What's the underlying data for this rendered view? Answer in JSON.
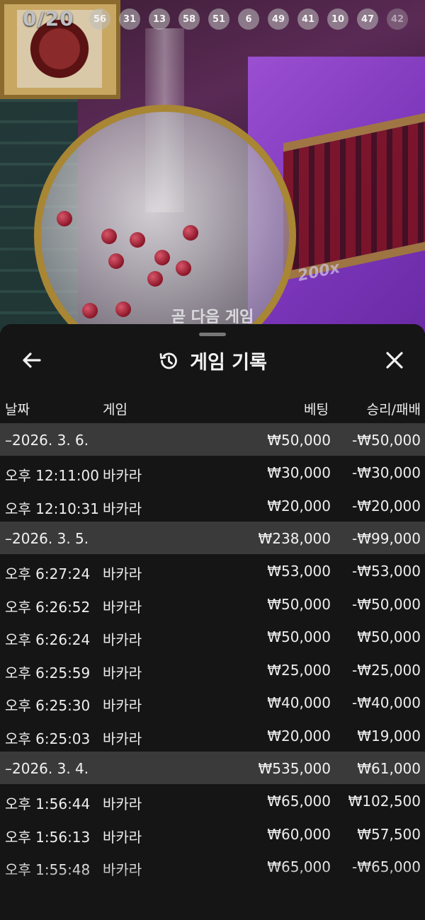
{
  "video": {
    "counter": "0/20",
    "balls": [
      "56",
      "31",
      "13",
      "58",
      "51",
      "6",
      "49",
      "41",
      "10",
      "47",
      "42"
    ],
    "multiplier": "200x",
    "next_game_text": "곧 다음 게임"
  },
  "sheet": {
    "title": "게임 기록",
    "icons": {
      "back": "arrow-left-icon",
      "history": "history-clock-icon",
      "close": "close-icon"
    }
  },
  "columns": {
    "date": "날짜",
    "game": "게임",
    "bet": "베팅",
    "result": "승리/패배"
  },
  "days": [
    {
      "date": "–2026. 3. 6.",
      "bet_total": "₩50,000",
      "result_total": "-₩50,000",
      "games": [
        {
          "time": "오후 12:11:00",
          "game": "바카라",
          "bet": "₩30,000",
          "result": "-₩30,000"
        },
        {
          "time": "오후 12:10:31",
          "game": "바카라",
          "bet": "₩20,000",
          "result": "-₩20,000"
        }
      ]
    },
    {
      "date": "–2026. 3. 5.",
      "bet_total": "₩238,000",
      "result_total": "-₩99,000",
      "games": [
        {
          "time": "오후 6:27:24",
          "game": "바카라",
          "bet": "₩53,000",
          "result": "-₩53,000"
        },
        {
          "time": "오후 6:26:52",
          "game": "바카라",
          "bet": "₩50,000",
          "result": "-₩50,000"
        },
        {
          "time": "오후 6:26:24",
          "game": "바카라",
          "bet": "₩50,000",
          "result": "₩50,000"
        },
        {
          "time": "오후 6:25:59",
          "game": "바카라",
          "bet": "₩25,000",
          "result": "-₩25,000"
        },
        {
          "time": "오후 6:25:30",
          "game": "바카라",
          "bet": "₩40,000",
          "result": "-₩40,000"
        },
        {
          "time": "오후 6:25:03",
          "game": "바카라",
          "bet": "₩20,000",
          "result": "₩19,000"
        }
      ]
    },
    {
      "date": "–2026. 3. 4.",
      "bet_total": "₩535,000",
      "result_total": "₩61,000",
      "games": [
        {
          "time": "오후 1:56:44",
          "game": "바카라",
          "bet": "₩65,000",
          "result": "₩102,500"
        },
        {
          "time": "오후 1:56:13",
          "game": "바카라",
          "bet": "₩60,000",
          "result": "₩57,500"
        },
        {
          "time": "오후 1:55:48",
          "game": "바카라",
          "bet": "₩65,000",
          "result": "-₩65,000"
        }
      ]
    }
  ]
}
